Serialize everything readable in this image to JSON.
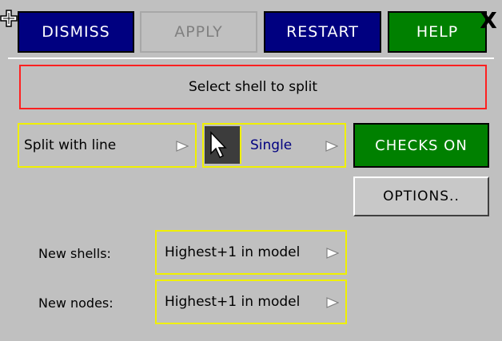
{
  "toolbar": {
    "dismiss_label": "DISMISS",
    "apply_label": "APPLY",
    "restart_label": "RESTART",
    "help_label": "HELP",
    "close_glyph": "X"
  },
  "prompt": {
    "text": "Select shell to split"
  },
  "split": {
    "method": "Split with line",
    "mode": "Single"
  },
  "checks_label": "CHECKS ON",
  "options_label": "OPTIONS..",
  "new_shells": {
    "label": "New shells:",
    "value": "Highest+1 in model"
  },
  "new_nodes": {
    "label": "New nodes:",
    "value": "Highest+1 in model"
  },
  "colors": {
    "panel_bg": "#c0c0c0",
    "navy_button": "#000080",
    "green_button": "#008000",
    "prompt_border": "#ff2020",
    "dropdown_border": "#f0f000"
  },
  "icons": [
    "move-icon",
    "close-icon",
    "dropdown-arrow-icon",
    "cursor-pick-icon"
  ]
}
